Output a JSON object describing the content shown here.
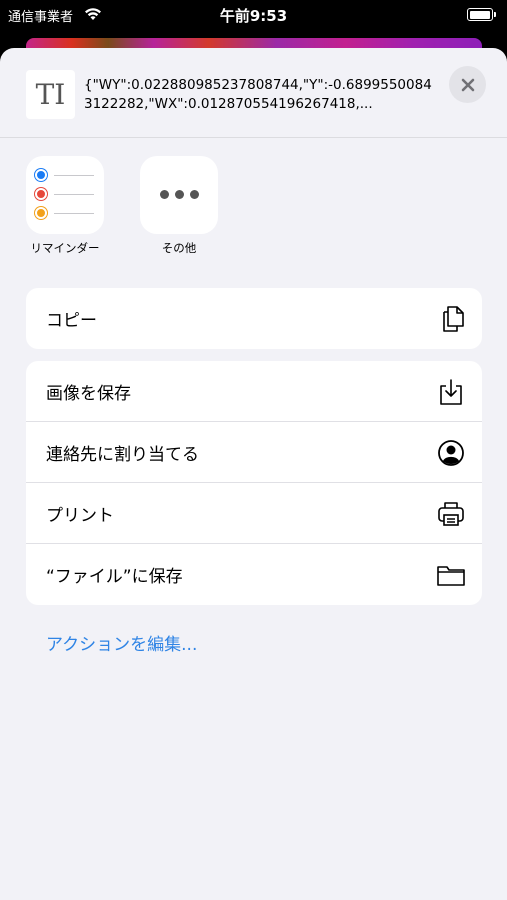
{
  "status_bar": {
    "carrier": "通信事業者",
    "time": "午前9:53",
    "battery_level": 1.0
  },
  "share_sheet": {
    "preview_text": "{\"WY\":0.022880985237808744,\"Y\":-0.68995500843122282,\"WX\":0.012870554196267418,...",
    "apps": [
      {
        "label": "リマインダー",
        "icon": "reminders-icon"
      },
      {
        "label": "その他",
        "icon": "more-icon"
      }
    ],
    "actions_group1": [
      {
        "label": "コピー",
        "icon": "copy-icon"
      }
    ],
    "actions_group2": [
      {
        "label": "画像を保存",
        "icon": "save-image-icon"
      },
      {
        "label": "連絡先に割り当てる",
        "icon": "contact-icon"
      },
      {
        "label": "プリント",
        "icon": "printer-icon"
      },
      {
        "label": "“ファイル”に保存",
        "icon": "folder-icon"
      }
    ],
    "edit_actions": "アクションを編集...",
    "colors": {
      "accent": "#2f84e5",
      "sheet_background": "#f2f2f7",
      "reminder_blue": "#1a7cf5",
      "reminder_red": "#e6483b",
      "reminder_orange": "#f2a11b"
    }
  }
}
